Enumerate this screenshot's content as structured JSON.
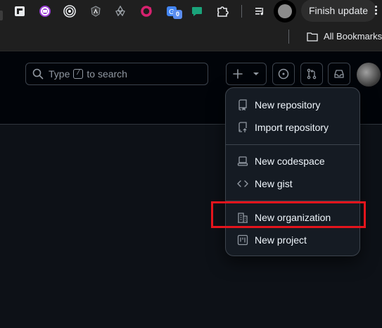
{
  "browser": {
    "finish_update_label": "Finish update",
    "extensions": [
      "flipboard-icon",
      "hypothesis-icon",
      "target-icon",
      "angular-icon",
      "shell-icon",
      "ring-icon",
      "translate-icon",
      "chat-icon",
      "puzzle-icon",
      "media-control-icon"
    ],
    "badge_count": "0"
  },
  "bookmarks": {
    "all_bookmarks_label": "All Bookmarks"
  },
  "header": {
    "search": {
      "prefix": "Type",
      "key": "/",
      "suffix": "to search"
    }
  },
  "create_menu": {
    "items": [
      {
        "label": "New repository",
        "icon": "repo-icon"
      },
      {
        "label": "Import repository",
        "icon": "repo-push-icon"
      },
      {
        "label": "New codespace",
        "icon": "codespace-icon"
      },
      {
        "label": "New gist",
        "icon": "code-icon"
      },
      {
        "label": "New organization",
        "icon": "organization-icon"
      },
      {
        "label": "New project",
        "icon": "project-icon"
      }
    ]
  },
  "colors": {
    "page_bg": "#0d1117",
    "header_bg": "#010409",
    "menu_bg": "#151b23",
    "highlight": "#e4141c"
  }
}
